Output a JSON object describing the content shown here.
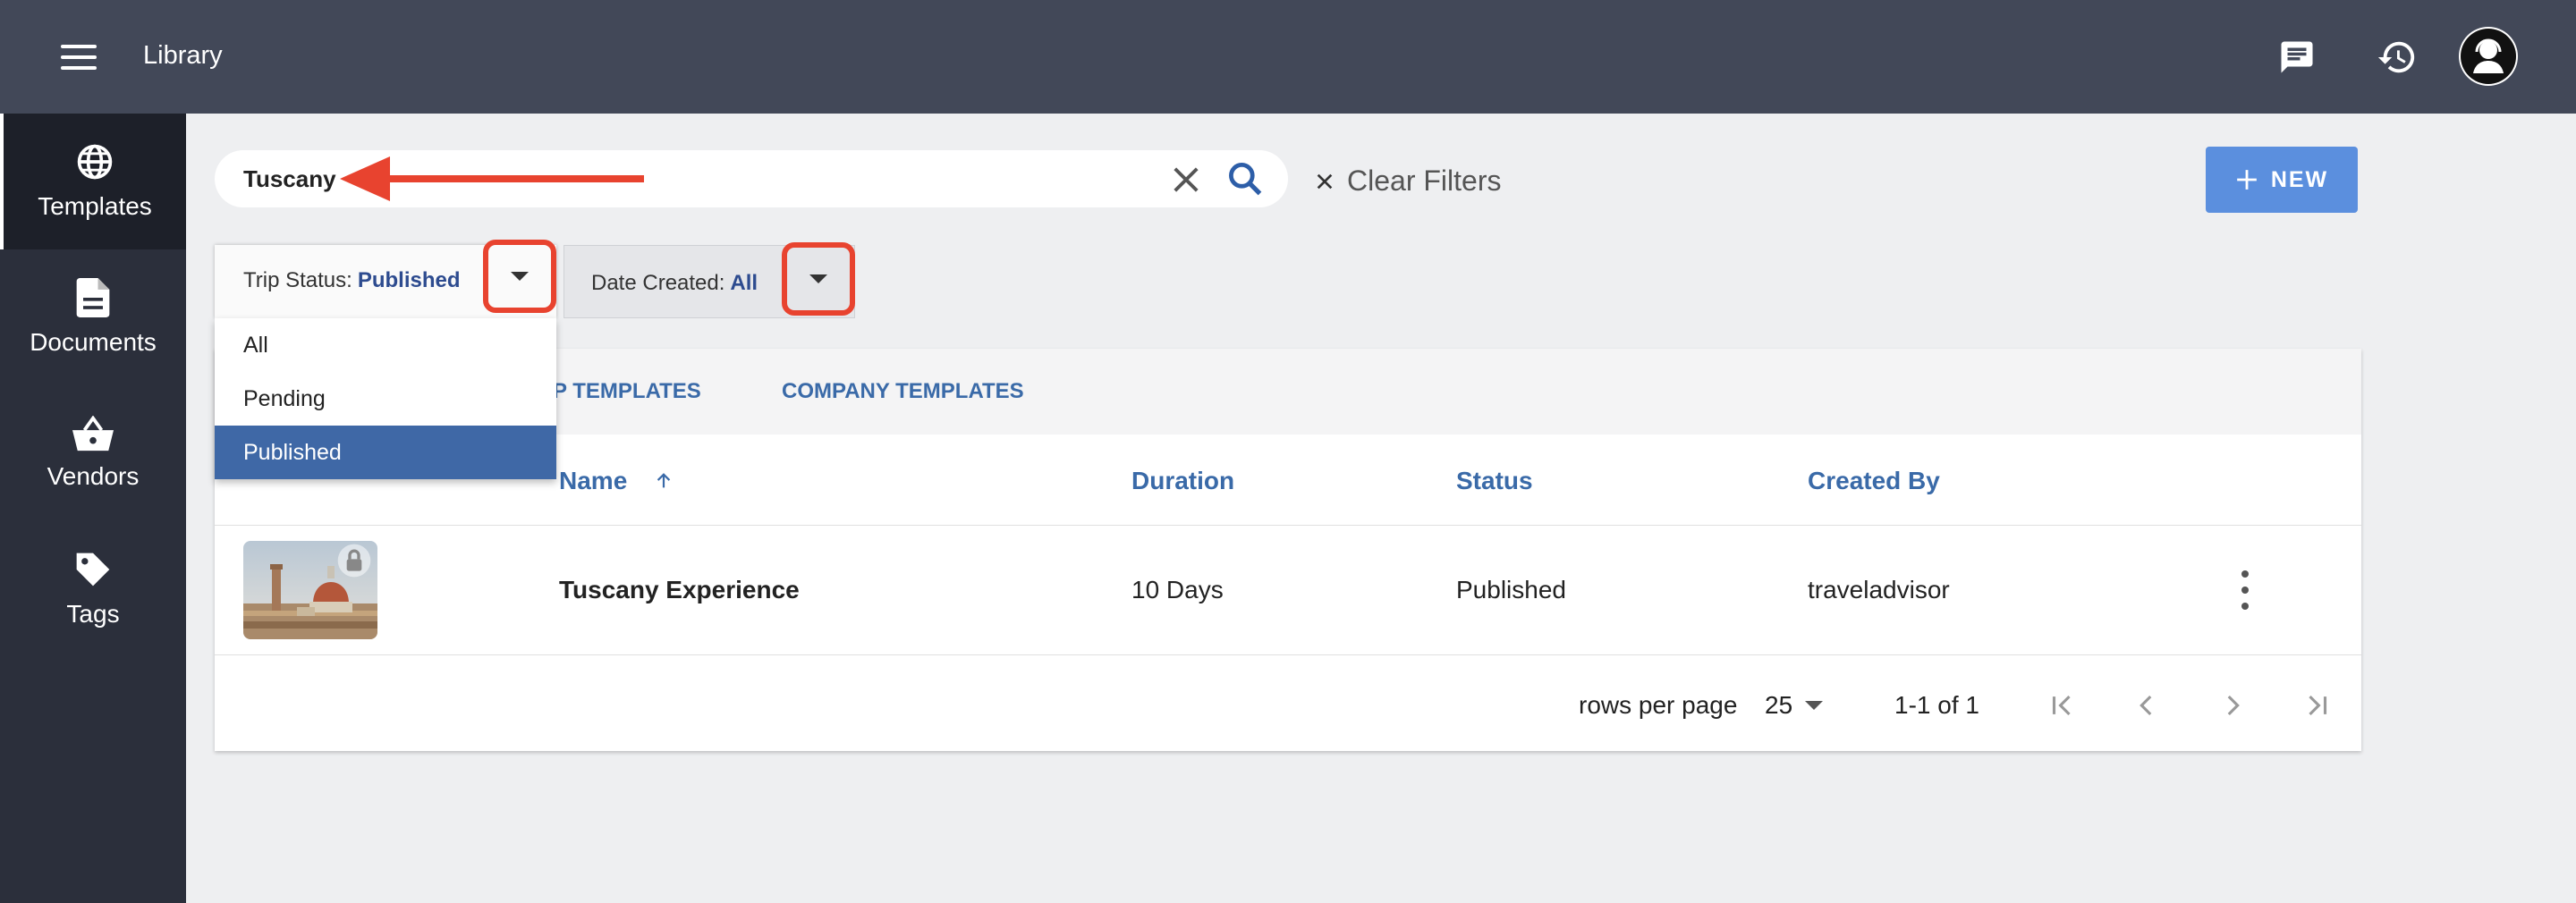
{
  "header": {
    "menu_icon": "hamburger-icon",
    "title": "Library",
    "chat_icon": "chat-icon",
    "history_icon": "history-icon",
    "avatar_icon": "user-avatar-icon"
  },
  "sidebar": {
    "items": [
      {
        "label": "Templates",
        "icon": "globe-icon",
        "active": true
      },
      {
        "label": "Documents",
        "icon": "document-icon",
        "active": false
      },
      {
        "label": "Vendors",
        "icon": "basket-icon",
        "active": false
      },
      {
        "label": "Tags",
        "icon": "tag-icon",
        "active": false
      }
    ]
  },
  "search": {
    "value": "Tuscany",
    "clear_icon": "close-icon",
    "search_icon": "search-icon"
  },
  "clear_filters": {
    "label": "Clear Filters",
    "icon": "close-icon"
  },
  "new_button": {
    "label": "NEW",
    "icon": "plus-icon"
  },
  "filters": {
    "trip_status": {
      "label": "Trip Status:",
      "value": "Published"
    },
    "date_created": {
      "label": "Date Created:",
      "value": "All"
    }
  },
  "dropdown": {
    "options": [
      {
        "label": "All",
        "selected": false
      },
      {
        "label": "Pending",
        "selected": false
      },
      {
        "label": "Published",
        "selected": true
      }
    ]
  },
  "tabs": [
    {
      "label": "P TEMPLATES"
    },
    {
      "label": "COMPANY TEMPLATES"
    }
  ],
  "table": {
    "columns": [
      "Name",
      "Duration",
      "Status",
      "Created By"
    ],
    "sort_icon": "arrow-up-icon",
    "rows": [
      {
        "name": "Tuscany Experience",
        "duration": "10 Days",
        "status": "Published",
        "created_by": "traveladvisor",
        "thumbnail": "florence-cathedral-image",
        "lock_icon": "lock-icon"
      }
    ]
  },
  "pagination": {
    "rows_per_page_label": "rows per page",
    "rows_per_page": "25",
    "range": "1-1 of 1"
  },
  "colors": {
    "topbar": "#424858",
    "sidebar": "#2b2f3b",
    "accent": "#3a6aa8",
    "new_button": "#5b8fde",
    "annotation": "#e8432f"
  }
}
